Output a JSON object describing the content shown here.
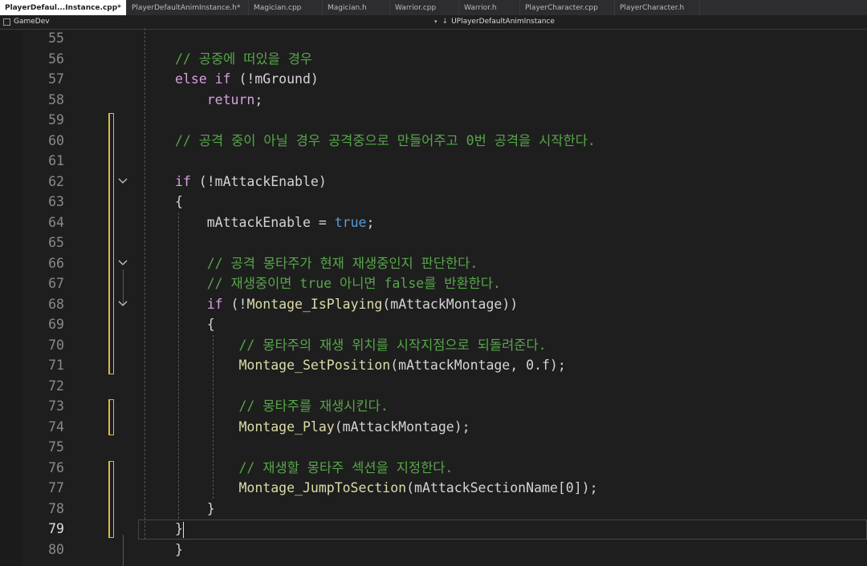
{
  "tabs": [
    {
      "label": "PlayerDefaul...Instance.cpp*",
      "active": true
    },
    {
      "label": "PlayerDefaultAnimInstance.h*",
      "active": false
    },
    {
      "label": "Magician.cpp",
      "active": false
    },
    {
      "label": "Magician.h",
      "active": false
    },
    {
      "label": "Warrior.cpp",
      "active": false
    },
    {
      "label": "Warrior.h",
      "active": false
    },
    {
      "label": "PlayerCharacter.cpp",
      "active": false
    },
    {
      "label": "PlayerCharacter.h",
      "active": false
    }
  ],
  "navbar": {
    "project": "GameDev",
    "scope": "UPlayerDefaultAnimInstance"
  },
  "editor": {
    "current_line": 79,
    "lines": [
      {
        "n": "55",
        "indent": "",
        "tokens": []
      },
      {
        "n": "56",
        "indent": "",
        "tokens": [
          {
            "c": "cmt",
            "t": "// 공중에 떠있을 경우"
          }
        ]
      },
      {
        "n": "57",
        "indent": "",
        "tokens": [
          {
            "c": "kw",
            "t": "else if"
          },
          {
            "c": "pl",
            "t": " (!mGround)"
          }
        ]
      },
      {
        "n": "58",
        "indent": "    ",
        "tokens": [
          {
            "c": "kw",
            "t": "return"
          },
          {
            "c": "pl",
            "t": ";"
          }
        ]
      },
      {
        "n": "59",
        "indent": "",
        "tokens": []
      },
      {
        "n": "60",
        "indent": "",
        "tokens": [
          {
            "c": "cmt",
            "t": "// 공격 중이 아닐 경우 공격중으로 만들어주고 0번 공격을 시작한다."
          }
        ]
      },
      {
        "n": "61",
        "indent": "",
        "tokens": []
      },
      {
        "n": "62",
        "indent": "",
        "tokens": [
          {
            "c": "kw",
            "t": "if"
          },
          {
            "c": "pl",
            "t": " (!mAttackEnable)"
          }
        ]
      },
      {
        "n": "63",
        "indent": "",
        "tokens": [
          {
            "c": "pl",
            "t": "{"
          }
        ]
      },
      {
        "n": "64",
        "indent": "    ",
        "tokens": [
          {
            "c": "pl",
            "t": "mAttackEnable = "
          },
          {
            "c": "kwb",
            "t": "true"
          },
          {
            "c": "pl",
            "t": ";"
          }
        ]
      },
      {
        "n": "65",
        "indent": "",
        "tokens": []
      },
      {
        "n": "66",
        "indent": "    ",
        "tokens": [
          {
            "c": "cmt",
            "t": "// 공격 몽타주가 현재 재생중인지 판단한다."
          }
        ]
      },
      {
        "n": "67",
        "indent": "    ",
        "tokens": [
          {
            "c": "cmt",
            "t": "// 재생중이면 true 아니면 false를 반환한다."
          }
        ]
      },
      {
        "n": "68",
        "indent": "    ",
        "tokens": [
          {
            "c": "kw",
            "t": "if"
          },
          {
            "c": "pl",
            "t": " (!"
          },
          {
            "c": "fn",
            "t": "Montage_IsPlaying"
          },
          {
            "c": "pl",
            "t": "(mAttackMontage))"
          }
        ]
      },
      {
        "n": "69",
        "indent": "    ",
        "tokens": [
          {
            "c": "pl",
            "t": "{"
          }
        ]
      },
      {
        "n": "70",
        "indent": "        ",
        "tokens": [
          {
            "c": "cmt",
            "t": "// 몽타주의 재생 위치를 시작지점으로 되돌려준다."
          }
        ]
      },
      {
        "n": "71",
        "indent": "        ",
        "tokens": [
          {
            "c": "fn",
            "t": "Montage_SetPosition"
          },
          {
            "c": "pl",
            "t": "(mAttackMontage, 0.f);"
          }
        ]
      },
      {
        "n": "72",
        "indent": "",
        "tokens": []
      },
      {
        "n": "73",
        "indent": "        ",
        "tokens": [
          {
            "c": "cmt",
            "t": "// 몽타주를 재생시킨다."
          }
        ]
      },
      {
        "n": "74",
        "indent": "        ",
        "tokens": [
          {
            "c": "fn",
            "t": "Montage_Play"
          },
          {
            "c": "pl",
            "t": "(mAttackMontage);"
          }
        ]
      },
      {
        "n": "75",
        "indent": "",
        "tokens": []
      },
      {
        "n": "76",
        "indent": "        ",
        "tokens": [
          {
            "c": "cmt",
            "t": "// 재생할 몽타주 섹션을 지정한다."
          }
        ]
      },
      {
        "n": "77",
        "indent": "        ",
        "tokens": [
          {
            "c": "fn",
            "t": "Montage_JumpToSection"
          },
          {
            "c": "pl",
            "t": "(mAttackSectionName[0]);"
          }
        ]
      },
      {
        "n": "78",
        "indent": "    ",
        "tokens": [
          {
            "c": "pl",
            "t": "}"
          }
        ]
      },
      {
        "n": "79",
        "indent": "",
        "tokens": [
          {
            "c": "pl",
            "t": "}"
          }
        ]
      },
      {
        "n": "80",
        "indent": "",
        "tokens": [
          {
            "c": "pl",
            "t": "}"
          }
        ]
      }
    ],
    "modified_ranges": [
      [
        59,
        71
      ],
      [
        73,
        74
      ],
      [
        76,
        79
      ]
    ],
    "fold_lines": [
      62,
      66,
      68
    ],
    "colors": {
      "comment": "#57a64a",
      "keyword": "#d8a0df",
      "literal": "#569cd6",
      "function": "#dcdcaa",
      "text": "#d4d4d4",
      "modified_marker": "#d7ba47",
      "background": "#1e1e1e"
    }
  }
}
